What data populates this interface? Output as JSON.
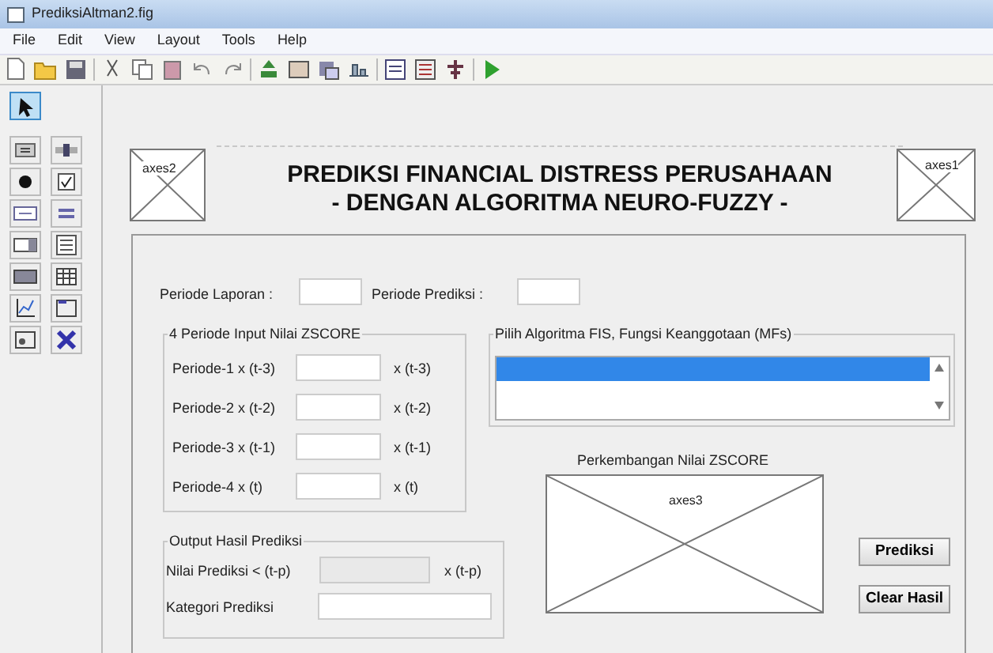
{
  "window": {
    "title": "PrediksiAltman2.fig"
  },
  "menu": [
    "File",
    "Edit",
    "View",
    "Layout",
    "Tools",
    "Help"
  ],
  "pointer_tool": {
    "selected": true
  },
  "palette": [
    {
      "kind": "pushbutton"
    },
    {
      "kind": "slider"
    },
    {
      "kind": "radio"
    },
    {
      "kind": "checkbox"
    },
    {
      "kind": "edit"
    },
    {
      "kind": "text"
    },
    {
      "kind": "popup"
    },
    {
      "kind": "listbox"
    },
    {
      "kind": "toggle"
    },
    {
      "kind": "table"
    },
    {
      "kind": "axes"
    },
    {
      "kind": "panel"
    },
    {
      "kind": "buttongroup"
    },
    {
      "kind": "activex"
    }
  ],
  "header": {
    "axes_left": "axes2",
    "title_lines": [
      "PREDIKSI FINANCIAL DISTRESS PERUSAHAAN",
      "- DENGAN ALGORITMA NEURO-FUZZY -"
    ],
    "axes_right": "axes1"
  },
  "periods": [
    {
      "label": "Periode Laporan :"
    },
    {
      "label": "Periode Prediksi :"
    }
  ],
  "input_panel": {
    "title": "4 Periode Input Nilai ZSCORE",
    "rows": [
      {
        "label": "Periode-1  x (t-3)",
        "unit": "x (t-3)"
      },
      {
        "label": "Periode-2  x (t-2)",
        "unit": "x (t-2)"
      },
      {
        "label": "Periode-3  x (t-1)",
        "unit": "x (t-1)"
      },
      {
        "label": "Periode-4  x (t)",
        "unit": "x (t)"
      }
    ]
  },
  "algorithm_panel": {
    "title": "Pilih Algoritma FIS, Fungsi Keanggotaan (MFs)",
    "items": [
      {
        "selected": true
      },
      {
        "selected": false
      }
    ]
  },
  "chart": {
    "title": "Perkembangan Nilai ZSCORE",
    "axes": "axes3"
  },
  "output_panel": {
    "title": "Output Hasil Prediksi",
    "rows": [
      {
        "label": "Nilai Prediksi < (t-p)",
        "unit": "x (t-p)",
        "disabled": true
      },
      {
        "label": "Kategori Prediksi",
        "disabled": false
      }
    ]
  },
  "buttons": [
    "Prediksi",
    "Clear Hasil"
  ]
}
